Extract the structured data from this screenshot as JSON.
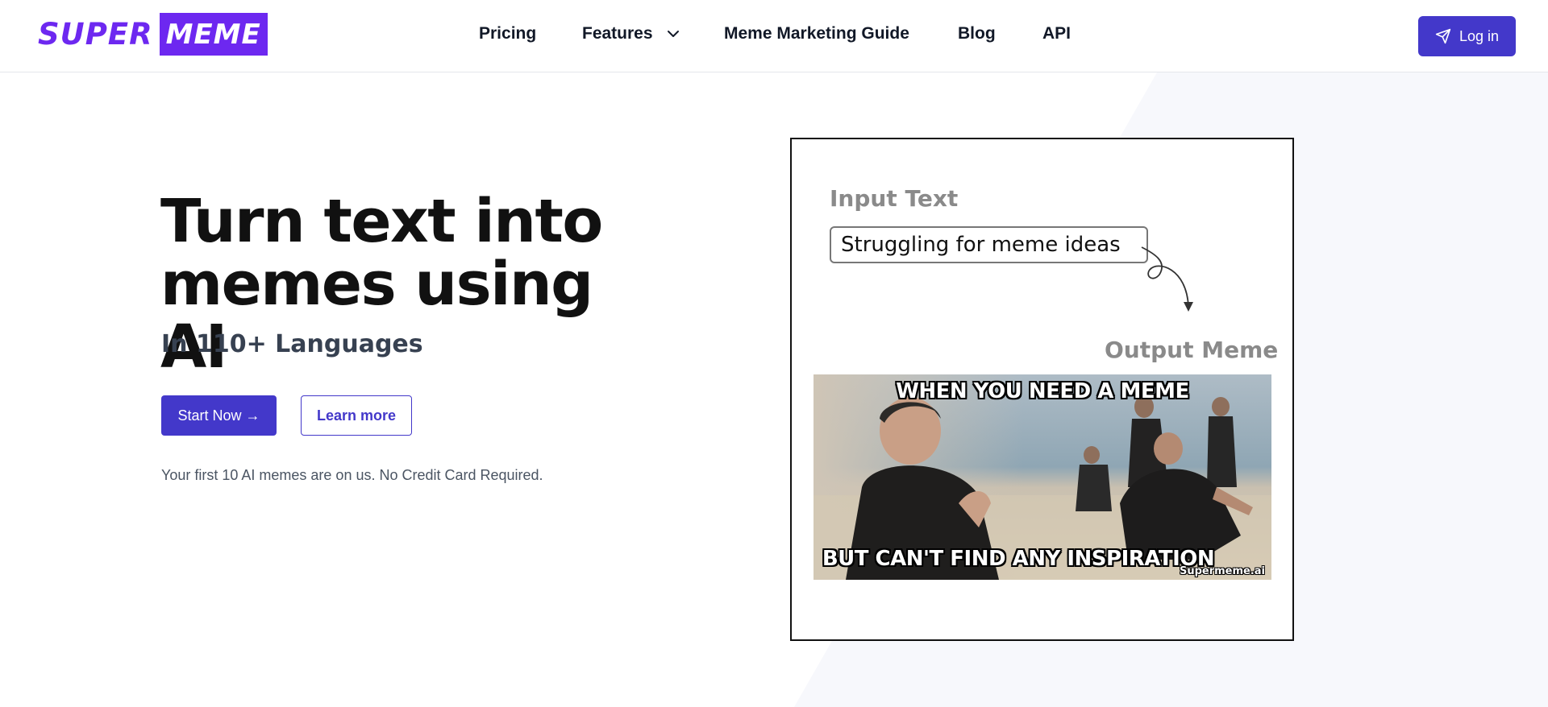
{
  "brand": {
    "logo_part1": "SUPER",
    "logo_part2": "MEME",
    "accent": "#6d28f0",
    "primary": "#4338ca"
  },
  "nav": {
    "items": [
      {
        "label": "Pricing"
      },
      {
        "label": "Features",
        "icon": "chevron-down-icon"
      },
      {
        "label": "Meme Marketing Guide"
      },
      {
        "label": "Blog"
      },
      {
        "label": "API"
      }
    ],
    "login_label": "Log in",
    "login_icon": "send-icon"
  },
  "hero": {
    "title": "Turn text into memes using AI",
    "subtitle": "In 110+ Languages",
    "primary_cta": "Start Now →",
    "secondary_cta": "Learn more",
    "note": "Your first 10 AI memes are on us. No Credit Card Required."
  },
  "demo": {
    "input_label": "Input Text",
    "input_value": "Struggling for meme ideas",
    "output_label": "Output Meme",
    "meme_top_text": "WHEN YOU NEED A MEME",
    "meme_bottom_text": "BUT CAN'T FIND ANY INSPIRATION",
    "meme_watermark": "Supermeme.ai"
  }
}
